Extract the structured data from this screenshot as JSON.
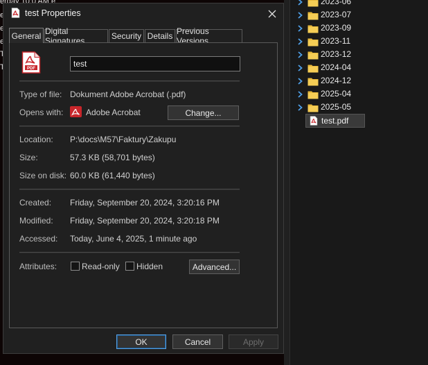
{
  "background": {
    "fragments": [
      "erday   10:0 AM  e",
      "e",
      "e",
      "e",
      "To",
      "To"
    ]
  },
  "dialog": {
    "title": "test Properties",
    "tabs": [
      {
        "label": "General",
        "active": true
      },
      {
        "label": "Digital Signatures"
      },
      {
        "label": "Security"
      },
      {
        "label": "Details"
      },
      {
        "label": "Previous Versions"
      }
    ],
    "file_icon": "pdf-file-icon",
    "name_value": "test",
    "type_label": "Type of file:",
    "type_value": "Dokument Adobe Acrobat (.pdf)",
    "opens_label": "Opens with:",
    "opens_app": "Adobe Acrobat",
    "change_button": "Change...",
    "location_label": "Location:",
    "location_value": "P:\\docs\\M57\\Faktury\\Zakupu",
    "size_label": "Size:",
    "size_value": "57.3 KB (58,701 bytes)",
    "size_disk_label": "Size on disk:",
    "size_disk_value": "60.0 KB (61,440 bytes)",
    "created_label": "Created:",
    "created_value": "Friday, September 20, 2024, 3:20:16 PM",
    "modified_label": "Modified:",
    "modified_value": "Friday, September 20, 2024, 3:20:18 PM",
    "accessed_label": "Accessed:",
    "accessed_value": "Today, June 4, 2025, 1 minute ago",
    "attributes_label": "Attributes:",
    "readonly_label": "Read-only",
    "readonly_checked": false,
    "hidden_label": "Hidden",
    "hidden_checked": false,
    "advanced_button": "Advanced...",
    "ok_button": "OK",
    "cancel_button": "Cancel",
    "apply_button": "Apply"
  },
  "explorer": {
    "folders": [
      "2023-06",
      "2023-07",
      "2023-09",
      "2023-11",
      "2023-12",
      "2024-04",
      "2024-12",
      "2025-04",
      "2025-05"
    ],
    "selected_file": "test.pdf"
  },
  "colors": {
    "pdf_red": "#c8262b",
    "folder_yellow": "#f0c040",
    "accent_blue": "#5aa0e0"
  }
}
